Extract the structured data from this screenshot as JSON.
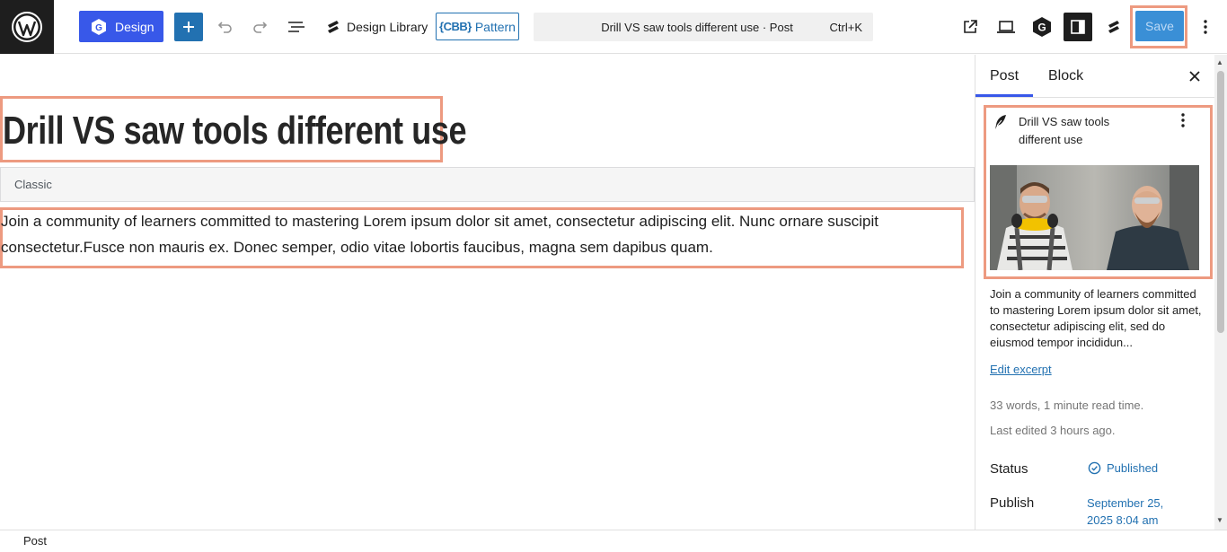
{
  "toolbar": {
    "design_label": "Design",
    "design_library_label": "Design Library",
    "pattern_badge": "CBB",
    "pattern_label": "Pattern",
    "command_title": "Drill VS saw tools different use · Post",
    "command_shortcut": "Ctrl+K",
    "save_label": "Save",
    "accent_color": "#3858e9"
  },
  "post": {
    "title": "Drill VS saw tools different use",
    "classic_label": "Classic",
    "body": "Join a community of learners committed to mastering Lorem ipsum dolor sit amet, consectetur adipiscing elit. Nunc ornare suscipit consectetur.Fusce non mauris ex. Donec semper, odio vitae lobortis faucibus, magna sem dapibus quam."
  },
  "sidebar": {
    "tabs": [
      {
        "label": "Post"
      },
      {
        "label": "Block"
      }
    ],
    "card_title": "Drill VS saw tools different use",
    "excerpt": "Join a community of learners committed to mastering Lorem ipsum dolor sit amet, consectetur adipiscing elit, sed do eiusmod tempor incididun...",
    "edit_excerpt_label": "Edit excerpt",
    "word_count": "33 words, 1 minute read time.",
    "last_edited": "Last edited 3 hours ago.",
    "status_label": "Status",
    "status_value": "Published",
    "publish_label": "Publish",
    "publish_value": "September 25, 2025 8:04 am"
  },
  "footer": {
    "breadcrumb": "Post"
  },
  "icons": {
    "wp": "wordpress-logo-icon",
    "undo": "undo-icon",
    "redo": "redo-icon",
    "list": "document-overview-icon"
  }
}
